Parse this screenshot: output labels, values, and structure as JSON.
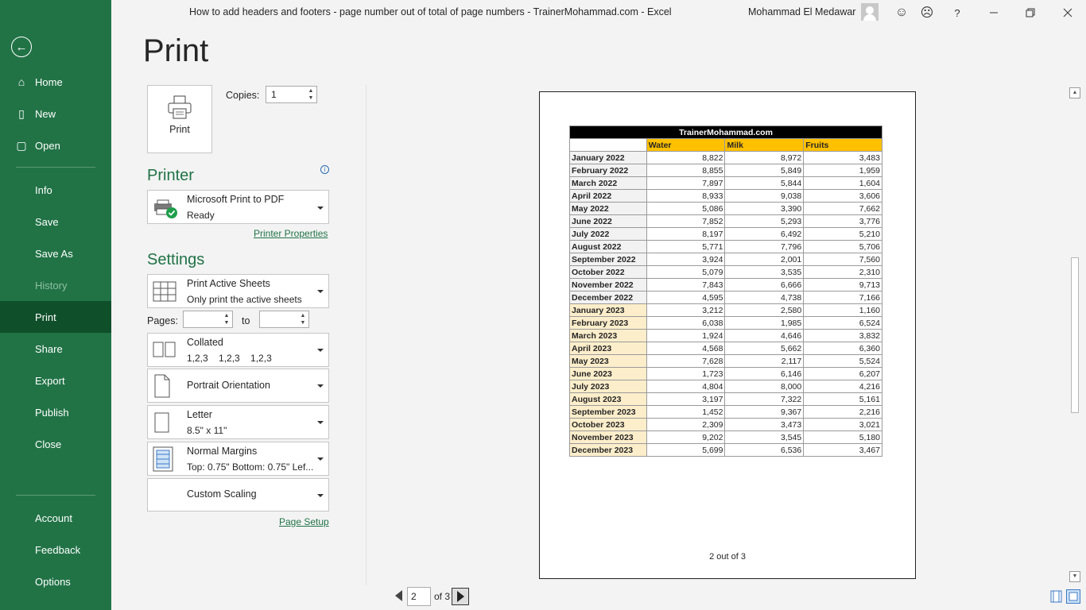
{
  "window": {
    "title": "How to add headers and footers - page number out of total of page numbers - TrainerMohammad.com  -  Excel",
    "user": "Mohammad El Medawar",
    "buttons": [
      "smile-icon",
      "frown-icon",
      "help-icon",
      "minimize-icon",
      "restore-icon",
      "close-icon"
    ],
    "help_glyph": "?"
  },
  "nav": {
    "items": [
      {
        "label": "Home",
        "icon": "home-icon"
      },
      {
        "label": "New",
        "icon": "new-document-icon"
      },
      {
        "label": "Open",
        "icon": "folder-open-icon"
      },
      {
        "label": "Info"
      },
      {
        "label": "Save"
      },
      {
        "label": "Save As"
      },
      {
        "label": "History",
        "disabled": true
      },
      {
        "label": "Print",
        "active": true
      },
      {
        "label": "Share"
      },
      {
        "label": "Export"
      },
      {
        "label": "Publish"
      },
      {
        "label": "Close"
      },
      {
        "label": "Account"
      },
      {
        "label": "Feedback"
      },
      {
        "label": "Options"
      }
    ]
  },
  "page": {
    "heading": "Print"
  },
  "print": {
    "button_label": "Print",
    "copies_label": "Copies:",
    "copies_value": "1"
  },
  "printer": {
    "heading": "Printer",
    "name": "Microsoft Print to PDF",
    "status": "Ready",
    "properties_link": "Printer Properties"
  },
  "settings": {
    "heading": "Settings",
    "what": {
      "title": "Print Active Sheets",
      "subtitle": "Only print the active sheets"
    },
    "pages_label": "Pages:",
    "to_label": "to",
    "pages_from": "",
    "pages_to": "",
    "collation": {
      "title": "Collated",
      "subtitle": "1,2,3    1,2,3    1,2,3"
    },
    "orientation": {
      "title": "Portrait Orientation"
    },
    "paper": {
      "title": "Letter",
      "subtitle": "8.5\" x 11\""
    },
    "margins": {
      "title": "Normal Margins",
      "subtitle": "Top: 0.75\" Bottom: 0.75\" Lef..."
    },
    "scaling": {
      "title": "Custom Scaling"
    },
    "page_setup_link": "Page Setup"
  },
  "preview": {
    "sheet_title": "TrainerMohammad.com",
    "headers": [
      "",
      "Water",
      "Milk",
      "Fruits"
    ],
    "rows": [
      {
        "month": "January 2022",
        "water": "8,822",
        "milk": "8,972",
        "fruits": "3,483"
      },
      {
        "month": "February 2022",
        "water": "8,855",
        "milk": "5,849",
        "fruits": "1,959"
      },
      {
        "month": "March 2022",
        "water": "7,897",
        "milk": "5,844",
        "fruits": "1,604"
      },
      {
        "month": "April 2022",
        "water": "8,933",
        "milk": "9,038",
        "fruits": "3,606"
      },
      {
        "month": "May 2022",
        "water": "5,086",
        "milk": "3,390",
        "fruits": "7,662"
      },
      {
        "month": "June 2022",
        "water": "7,852",
        "milk": "5,293",
        "fruits": "3,776"
      },
      {
        "month": "July 2022",
        "water": "8,197",
        "milk": "6,492",
        "fruits": "5,210"
      },
      {
        "month": "August 2022",
        "water": "5,771",
        "milk": "7,796",
        "fruits": "5,706"
      },
      {
        "month": "September 2022",
        "water": "3,924",
        "milk": "2,001",
        "fruits": "7,560"
      },
      {
        "month": "October 2022",
        "water": "5,079",
        "milk": "3,535",
        "fruits": "2,310"
      },
      {
        "month": "November 2022",
        "water": "7,843",
        "milk": "6,666",
        "fruits": "9,713"
      },
      {
        "month": "December 2022",
        "water": "4,595",
        "milk": "4,738",
        "fruits": "7,166"
      },
      {
        "month": "January 2023",
        "water": "3,212",
        "milk": "2,580",
        "fruits": "1,160"
      },
      {
        "month": "February 2023",
        "water": "6,038",
        "milk": "1,985",
        "fruits": "6,524"
      },
      {
        "month": "March 2023",
        "water": "1,924",
        "milk": "4,646",
        "fruits": "3,832"
      },
      {
        "month": "April 2023",
        "water": "4,568",
        "milk": "5,662",
        "fruits": "6,360"
      },
      {
        "month": "May 2023",
        "water": "7,628",
        "milk": "2,117",
        "fruits": "5,524"
      },
      {
        "month": "June 2023",
        "water": "1,723",
        "milk": "6,146",
        "fruits": "6,207"
      },
      {
        "month": "July 2023",
        "water": "4,804",
        "milk": "8,000",
        "fruits": "4,216"
      },
      {
        "month": "August 2023",
        "water": "3,197",
        "milk": "7,322",
        "fruits": "5,161"
      },
      {
        "month": "September 2023",
        "water": "1,452",
        "milk": "9,367",
        "fruits": "2,216"
      },
      {
        "month": "October 2023",
        "water": "2,309",
        "milk": "3,473",
        "fruits": "3,021"
      },
      {
        "month": "November 2023",
        "water": "9,202",
        "milk": "3,545",
        "fruits": "5,180"
      },
      {
        "month": "December 2023",
        "water": "5,699",
        "milk": "6,536",
        "fruits": "3,467"
      }
    ],
    "footer": "2 out of 3"
  },
  "pager": {
    "current": "2",
    "of_label": "of 3"
  },
  "colors": {
    "accent": "#217346",
    "nav_active": "#0f4f2a",
    "header_fill": "#ffc000",
    "year2023_fill": "#fdeecb"
  }
}
